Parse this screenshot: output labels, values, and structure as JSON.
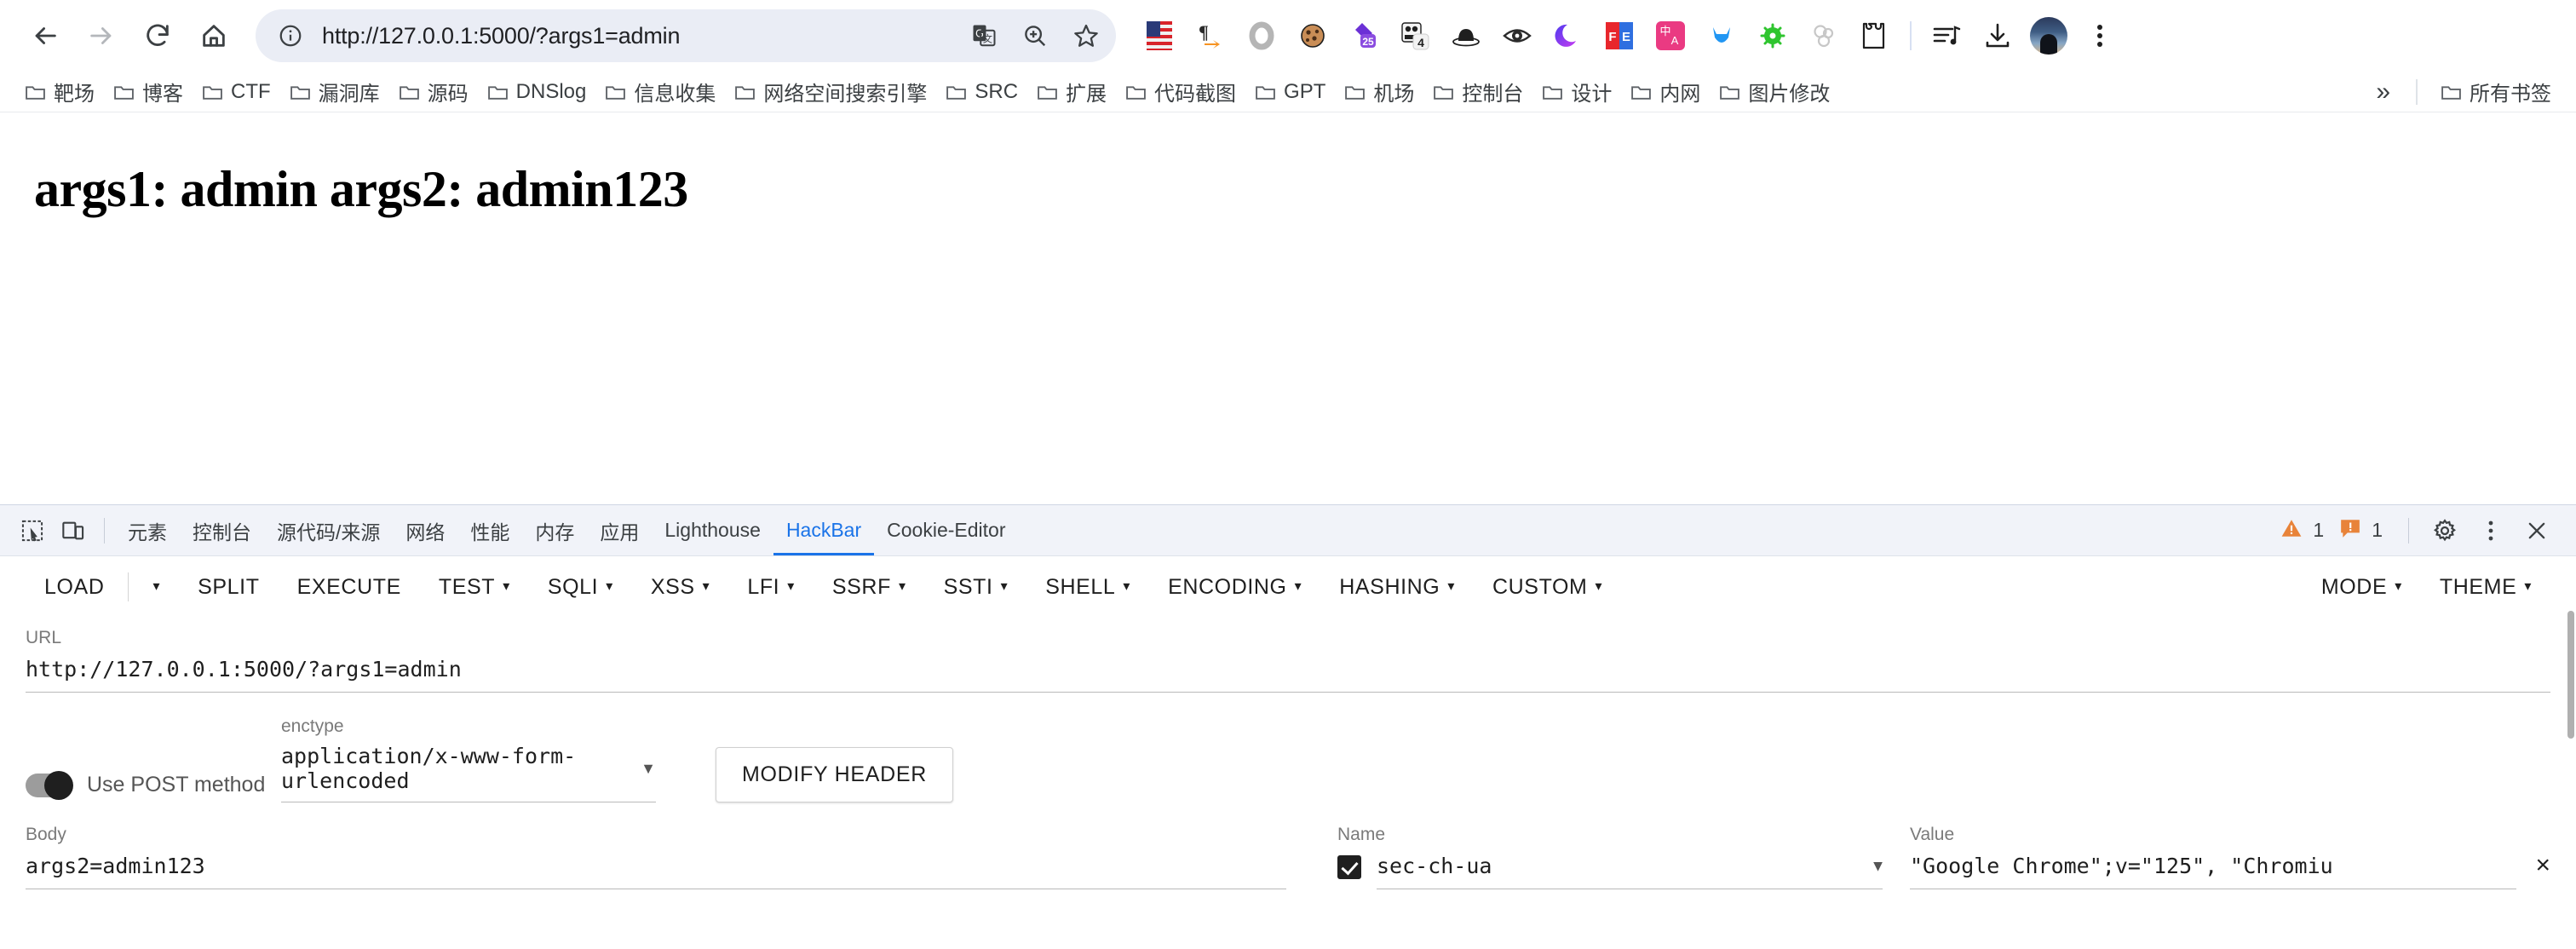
{
  "browser": {
    "nav": {
      "back": "back-arrow",
      "forward": "forward-arrow",
      "reload": "reload",
      "home": "home"
    },
    "omnibox": {
      "site_info_icon": "info-circle-icon",
      "url": "http://127.0.0.1:5000/?args1=admin",
      "translate_icon": "google-translate-icon",
      "zoom_icon": "zoom-magnifier-icon",
      "bookmark_icon": "star-icon"
    },
    "extensions": [
      {
        "name": "us-flag-extension",
        "glyph": "🇺🇸"
      },
      {
        "name": "pilcrow-arrow-extension",
        "glyph": "¶"
      },
      {
        "name": "ring-extension",
        "glyph": "⭕"
      },
      {
        "name": "cookie-extension",
        "glyph": "🍪"
      },
      {
        "name": "badge-25-extension",
        "glyph": "25"
      },
      {
        "name": "panda-4-extension",
        "glyph": "4"
      },
      {
        "name": "hat-extension",
        "glyph": "🎩"
      },
      {
        "name": "eye-extension",
        "glyph": "👁"
      },
      {
        "name": "moon-dark-mode-extension",
        "glyph": "🌙"
      },
      {
        "name": "fe-extension",
        "glyph": "FE"
      },
      {
        "name": "translate-cn-extension",
        "glyph": "中 A"
      },
      {
        "name": "blue-cat-extension",
        "glyph": "🐱"
      },
      {
        "name": "green-bug-extension",
        "glyph": "🐛"
      },
      {
        "name": "bubbles-extension",
        "glyph": "○"
      },
      {
        "name": "puzzle-extensions-button",
        "glyph": "🧩"
      }
    ],
    "right_actions": [
      {
        "name": "playlist-music-icon",
        "glyph": "≡"
      },
      {
        "name": "downloads-icon",
        "glyph": "⬇"
      },
      {
        "name": "profile-avatar",
        "glyph": ""
      },
      {
        "name": "chrome-menu-icon",
        "glyph": "⋮"
      }
    ],
    "bookmarks": [
      "靶场",
      "博客",
      "CTF",
      "漏洞库",
      "源码",
      "DNSlog",
      "信息收集",
      "网络空间搜索引擎",
      "SRC",
      "扩展",
      "代码截图",
      "GPT",
      "机场",
      "控制台",
      "设计",
      "内网",
      "图片修改"
    ],
    "bookmarks_overflow": "»",
    "all_bookmarks": "所有书签"
  },
  "page": {
    "heading": "args1: admin args2: admin123"
  },
  "devtools": {
    "inspect_icon": "inspect-element-icon",
    "device_icon": "device-toolbar-icon",
    "tabs": [
      {
        "label": "元素",
        "active": false
      },
      {
        "label": "控制台",
        "active": false
      },
      {
        "label": "源代码/来源",
        "active": false
      },
      {
        "label": "网络",
        "active": false
      },
      {
        "label": "性能",
        "active": false
      },
      {
        "label": "内存",
        "active": false
      },
      {
        "label": "应用",
        "active": false
      },
      {
        "label": "Lighthouse",
        "active": false
      },
      {
        "label": "HackBar",
        "active": true
      },
      {
        "label": "Cookie-Editor",
        "active": false
      }
    ],
    "warning_count": "1",
    "issue_count": "1",
    "warning_color": "#e8833a",
    "issue_color": "#e8833a",
    "settings_icon": "gear-icon",
    "more_icon": "more-vertical-icon",
    "close_icon": "close-icon",
    "active_tab_color": "#1a73e8"
  },
  "hackbar": {
    "buttons": [
      {
        "label": "LOAD",
        "dropdown": false
      },
      {
        "label": "",
        "dropdown": true,
        "name": "load-dropdown"
      },
      {
        "label": "SPLIT",
        "dropdown": false
      },
      {
        "label": "EXECUTE",
        "dropdown": false
      },
      {
        "label": "TEST",
        "dropdown": true
      },
      {
        "label": "SQLI",
        "dropdown": true
      },
      {
        "label": "XSS",
        "dropdown": true
      },
      {
        "label": "LFI",
        "dropdown": true
      },
      {
        "label": "SSRF",
        "dropdown": true
      },
      {
        "label": "SSTI",
        "dropdown": true
      },
      {
        "label": "SHELL",
        "dropdown": true
      },
      {
        "label": "ENCODING",
        "dropdown": true
      },
      {
        "label": "HASHING",
        "dropdown": true
      },
      {
        "label": "CUSTOM",
        "dropdown": true
      }
    ],
    "right_buttons": [
      {
        "label": "MODE",
        "dropdown": true
      },
      {
        "label": "THEME",
        "dropdown": true
      }
    ],
    "url_label": "URL",
    "url_value": "http://127.0.0.1:5000/?args1=admin",
    "post_toggle_label": "Use POST method",
    "post_toggle_on": true,
    "enctype_label": "enctype",
    "enctype_value": "application/x-www-form-urlencoded",
    "modify_header_label": "MODIFY HEADER",
    "body_label": "Body",
    "body_value": "args2=admin123",
    "header_name_label": "Name",
    "header_value_label": "Value",
    "header_rows": [
      {
        "enabled": true,
        "name": "sec-ch-ua",
        "value": "\"Google Chrome\";v=\"125\", \"Chromiu",
        "remove": "×"
      }
    ]
  }
}
